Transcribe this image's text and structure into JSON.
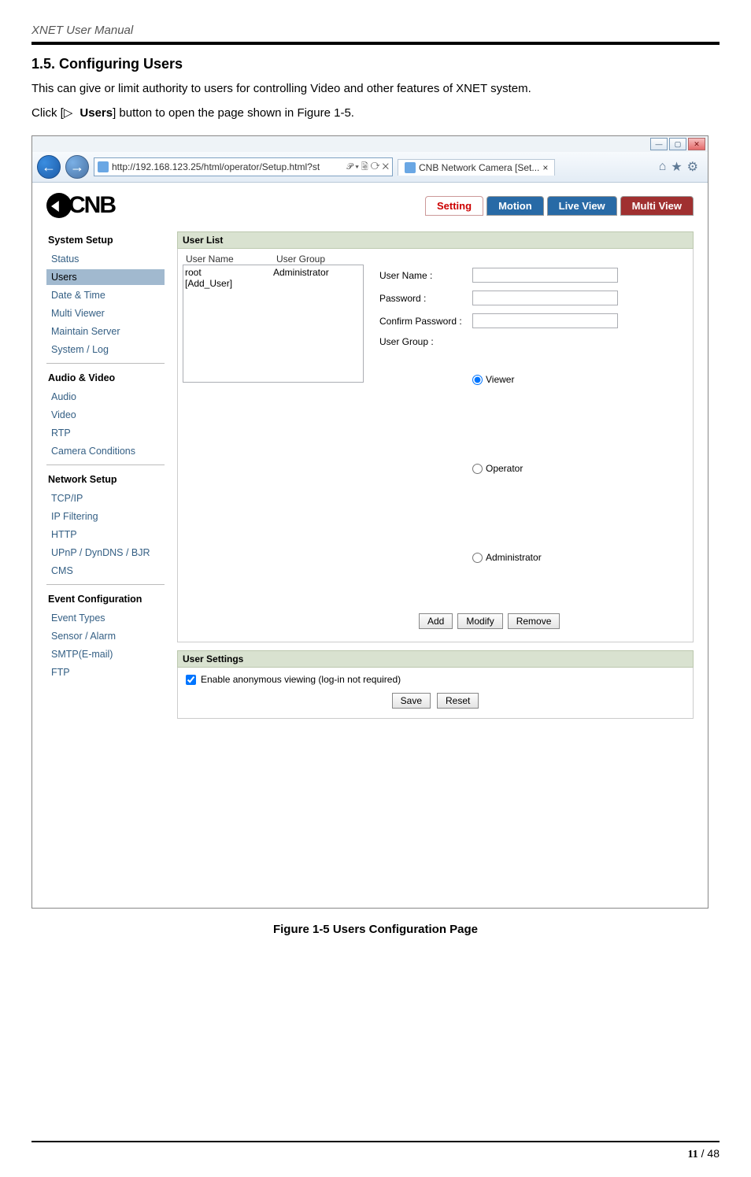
{
  "doc": {
    "header_title": "XNET User Manual",
    "section_heading": "1.5. Configuring Users",
    "intro_text": "This can give or limit authority to users for controlling Video and other features of XNET system.",
    "click_prefix": "Click [",
    "click_tri": "▷ ",
    "click_bold": "Users",
    "click_suffix": "] button to open the page shown in Figure 1-5.",
    "figure_caption": "Figure 1-5 Users Configuration Page",
    "page_current": "11",
    "page_sep": " / ",
    "page_total": "48"
  },
  "browser": {
    "win_min": "—",
    "win_max": "▢",
    "win_close": "✕",
    "back_glyph": "←",
    "fwd_glyph": "→",
    "address": "http://192.168.123.25/html/operator/Setup.html?st",
    "addr_tail": "𝒫 ▾ 🗟 ⟳ ✕",
    "tab_title": "CNB Network Camera [Set...",
    "tab_close": "×",
    "tool_home": "⌂",
    "tool_star": "★",
    "tool_gear": "⚙"
  },
  "app": {
    "logo_text": "CNB",
    "tabs": {
      "setting": "Setting",
      "motion": "Motion",
      "liveview": "Live View",
      "multiview": "Multi View"
    }
  },
  "sidebar": {
    "g1": "System Setup",
    "g1_items": {
      "status": "Status",
      "users": "Users",
      "datetime": "Date & Time",
      "multiviewer": "Multi Viewer",
      "maintain": "Maintain Server",
      "syslog": "System / Log"
    },
    "g2": "Audio & Video",
    "g2_items": {
      "audio": "Audio",
      "video": "Video",
      "rtp": "RTP",
      "camcond": "Camera Conditions"
    },
    "g3": "Network Setup",
    "g3_items": {
      "tcpip": "TCP/IP",
      "ipfilt": "IP Filtering",
      "http": "HTTP",
      "upnp": "UPnP / DynDNS / BJR",
      "cms": "CMS"
    },
    "g4": "Event Configuration",
    "g4_items": {
      "evt": "Event Types",
      "sensor": "Sensor / Alarm",
      "smtp": "SMTP(E-mail)",
      "ftp": "FTP"
    }
  },
  "panel": {
    "userlist_title": "User List",
    "col_name": "User Name",
    "col_group": "User Group",
    "rows": [
      {
        "name": "root",
        "group": "Administrator"
      },
      {
        "name": "[Add_User]",
        "group": ""
      }
    ],
    "lbl_username": "User Name :",
    "lbl_password": "Password :",
    "lbl_confirm": "Confirm Password :",
    "lbl_usergroup": "User Group :",
    "radio_viewer": "Viewer",
    "radio_operator": "Operator",
    "radio_admin": "Administrator",
    "btn_add": "Add",
    "btn_modify": "Modify",
    "btn_remove": "Remove",
    "usersettings_title": "User Settings",
    "chk_anon": "Enable anonymous viewing (log-in not required)",
    "btn_save": "Save",
    "btn_reset": "Reset"
  }
}
